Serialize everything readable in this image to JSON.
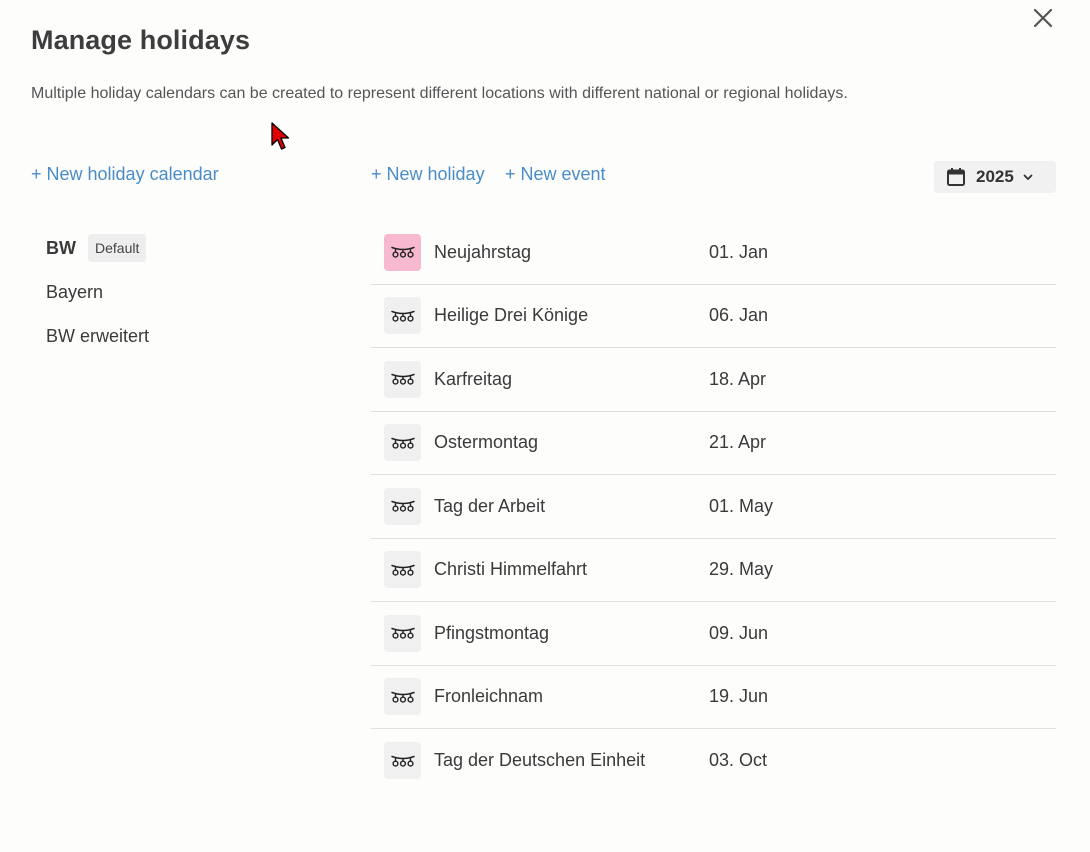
{
  "dialog": {
    "title": "Manage holidays",
    "description": "Multiple holiday calendars can be created to represent different locations with different national or regional holidays."
  },
  "actions": {
    "new_calendar": "+ New holiday calendar",
    "new_holiday": "+ New holiday",
    "new_event": "+ New event"
  },
  "year_picker": {
    "value": "2025",
    "icon": "calendar-icon"
  },
  "calendars": [
    {
      "name": "BW",
      "badge": "Default",
      "active": true
    },
    {
      "name": "Bayern"
    },
    {
      "name": "BW erweitert"
    }
  ],
  "holidays": [
    {
      "name": "Neujahrstag",
      "date": "01. Jan",
      "highlight": true
    },
    {
      "name": "Heilige Drei Könige",
      "date": "06. Jan"
    },
    {
      "name": "Karfreitag",
      "date": "18. Apr"
    },
    {
      "name": "Ostermontag",
      "date": "21. Apr"
    },
    {
      "name": "Tag der Arbeit",
      "date": "01. May"
    },
    {
      "name": "Christi Himmelfahrt",
      "date": "29. May"
    },
    {
      "name": "Pfingstmontag",
      "date": "09. Jun"
    },
    {
      "name": "Fronleichnam",
      "date": "19. Jun"
    },
    {
      "name": "Tag der Deutschen Einheit",
      "date": "03. Oct"
    }
  ],
  "colors": {
    "accent": "#4a8cc7",
    "highlight_icon_bg": "#f6b9cf",
    "icon_bg": "#f0f0f0",
    "cursor": "#e00000"
  }
}
